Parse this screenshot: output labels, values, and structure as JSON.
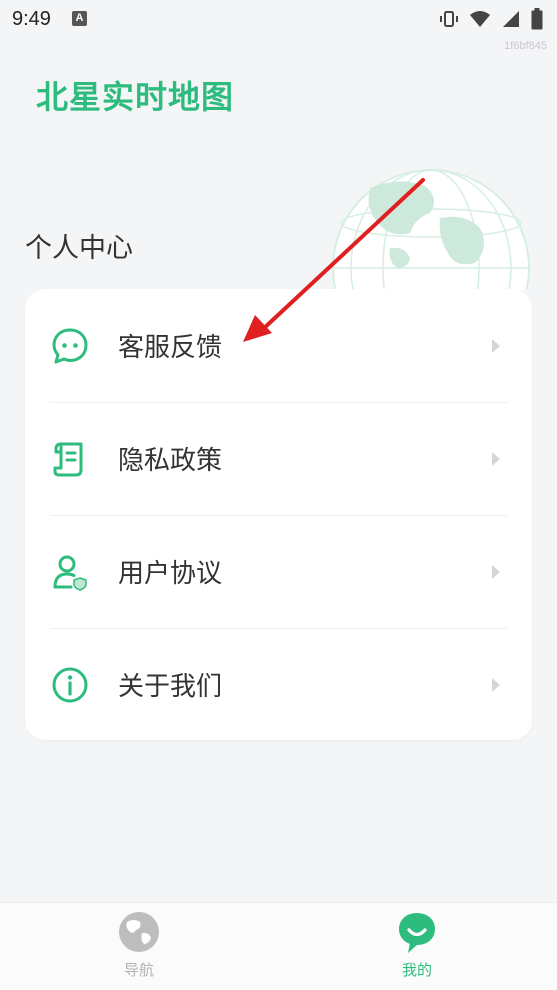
{
  "status_bar": {
    "time": "9:49",
    "notification_glyph": "A",
    "icons": [
      "vibrate-icon",
      "wifi-icon",
      "signal-icon",
      "battery-icon"
    ]
  },
  "build_id": "1f6bf845",
  "app": {
    "name": "北星实时地图",
    "accent_color": "#2ebc7e"
  },
  "page": {
    "section_title": "个人中心"
  },
  "menu": {
    "items": [
      {
        "label": "客服反馈",
        "icon": "chat-bubble-icon"
      },
      {
        "label": "隐私政策",
        "icon": "document-scroll-icon"
      },
      {
        "label": "用户协议",
        "icon": "user-shield-icon"
      },
      {
        "label": "关于我们",
        "icon": "info-icon"
      }
    ]
  },
  "bottom_nav": {
    "tabs": [
      {
        "label": "导航",
        "icon": "globe-icon",
        "active": false
      },
      {
        "label": "我的",
        "icon": "smile-bubble-icon",
        "active": true
      }
    ]
  }
}
